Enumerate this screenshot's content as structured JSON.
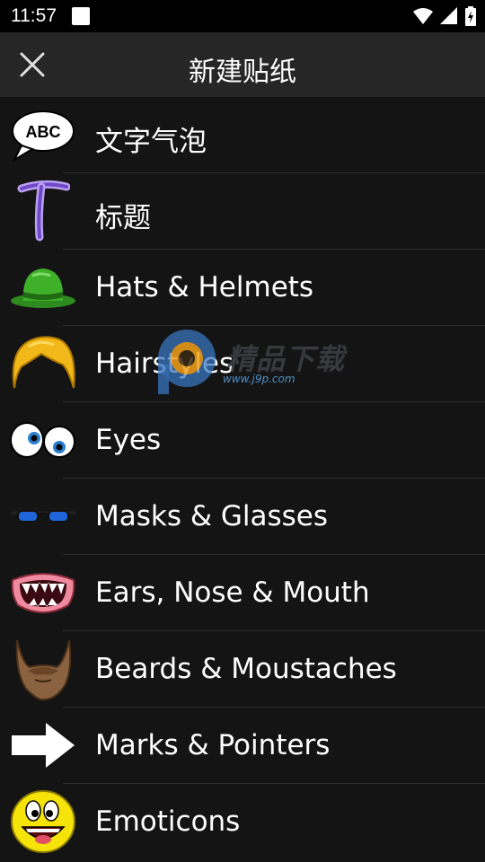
{
  "status_bar": {
    "time": "11:57"
  },
  "app_bar": {
    "title": "新建贴纸",
    "close_icon": "close-icon"
  },
  "items": [
    {
      "label": "文字气泡",
      "icon": "speech-bubble-abc"
    },
    {
      "label": "标题",
      "icon": "title-t"
    },
    {
      "label": "Hats & Helmets",
      "icon": "green-hat"
    },
    {
      "label": "Hairstyles",
      "icon": "blond-hair"
    },
    {
      "label": "Eyes",
      "icon": "cartoon-eyes"
    },
    {
      "label": "Masks & Glasses",
      "icon": "blue-glasses"
    },
    {
      "label": "Ears, Nose & Mouth",
      "icon": "monster-mouth"
    },
    {
      "label": "Beards & Moustaches",
      "icon": "brown-beard"
    },
    {
      "label": "Marks & Pointers",
      "icon": "white-arrow"
    },
    {
      "label": "Emoticons",
      "icon": "smiley-face"
    }
  ],
  "watermark": {
    "text": "精品下载",
    "url": "www.j9p.com"
  },
  "colors": {
    "background": "#141414",
    "app_bar": "#262626",
    "status_bar": "#000000"
  }
}
